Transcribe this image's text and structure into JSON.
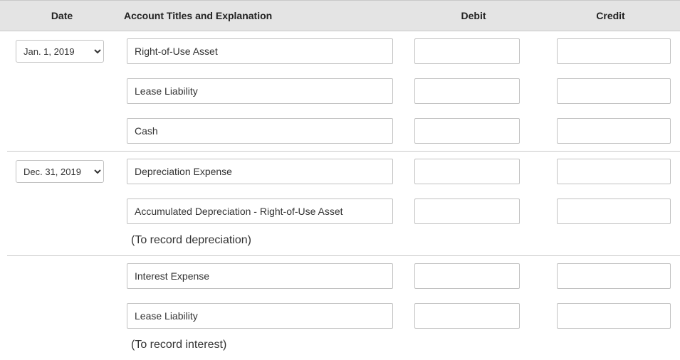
{
  "columns": {
    "date": "Date",
    "account": "Account Titles and Explanation",
    "debit": "Debit",
    "credit": "Credit"
  },
  "sections": [
    {
      "date_value": "Jan. 1, 2019",
      "date_options": [
        "Jan. 1, 2019",
        "Dec. 31, 2019"
      ],
      "lines": [
        {
          "account": "Right-of-Use Asset",
          "debit": "",
          "credit": ""
        },
        {
          "account": "Lease Liability",
          "debit": "",
          "credit": ""
        },
        {
          "account": "Cash",
          "debit": "",
          "credit": ""
        }
      ],
      "explanation": ""
    },
    {
      "date_value": "Dec. 31, 2019",
      "date_options": [
        "Jan. 1, 2019",
        "Dec. 31, 2019"
      ],
      "lines": [
        {
          "account": "Depreciation Expense",
          "debit": "",
          "credit": ""
        },
        {
          "account": "Accumulated Depreciation - Right-of-Use Asset",
          "debit": "",
          "credit": ""
        }
      ],
      "explanation": "(To record depreciation)"
    },
    {
      "date_value": "",
      "date_options": [],
      "lines": [
        {
          "account": "Interest Expense",
          "debit": "",
          "credit": ""
        },
        {
          "account": "Lease Liability",
          "debit": "",
          "credit": ""
        }
      ],
      "explanation": "(To record interest)"
    }
  ]
}
